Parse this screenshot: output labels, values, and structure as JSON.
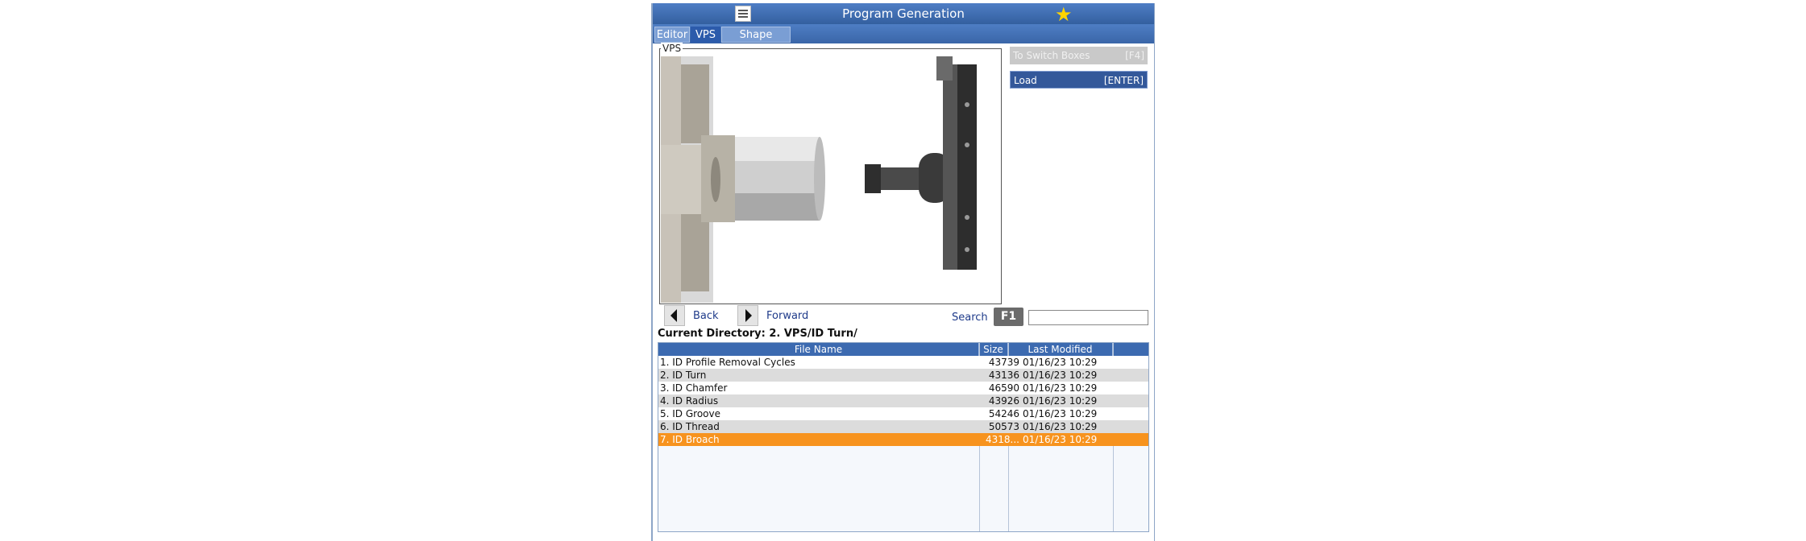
{
  "window": {
    "title": "Program Generation",
    "menu_icon": "hamburger-menu-icon",
    "star_icon": "star-icon"
  },
  "tabs": [
    {
      "label": "Editor",
      "active": false
    },
    {
      "label": "VPS",
      "active": true
    },
    {
      "label": "Shape Creator",
      "active": false
    }
  ],
  "preview": {
    "legend": "VPS"
  },
  "side_buttons": {
    "switch_label": "To Switch Boxes",
    "switch_key": "[F4]",
    "load_label": "Load",
    "load_key": "[ENTER]"
  },
  "navigation": {
    "back_label": "Back",
    "forward_label": "Forward",
    "search_label": "Search",
    "search_key": "F1",
    "search_value": ""
  },
  "current_directory": "Current Directory: 2. VPS/ID Turn/",
  "table": {
    "headers": {
      "name": "File Name",
      "size": "Size",
      "modified": "Last Modified"
    },
    "rows": [
      {
        "name": "1. ID Profile Removal Cycles",
        "size": "43739",
        "modified": "01/16/23 10:29"
      },
      {
        "name": "2. ID Turn",
        "size": "43136",
        "modified": "01/16/23 10:29"
      },
      {
        "name": "3. ID Chamfer",
        "size": "46590",
        "modified": "01/16/23 10:29"
      },
      {
        "name": "4. ID Radius",
        "size": "43926",
        "modified": "01/16/23 10:29"
      },
      {
        "name": "5. ID Groove",
        "size": "54246",
        "modified": "01/16/23 10:29"
      },
      {
        "name": "6. ID Thread",
        "size": "50573",
        "modified": "01/16/23 10:29"
      },
      {
        "name": "7. ID Broach",
        "size": "4318...",
        "modified": "01/16/23 10:29"
      }
    ],
    "selected_index": 6
  },
  "colors": {
    "title_bar": "#3a66a8",
    "selected_row": "#f7931e",
    "load_button": "#33589a"
  }
}
